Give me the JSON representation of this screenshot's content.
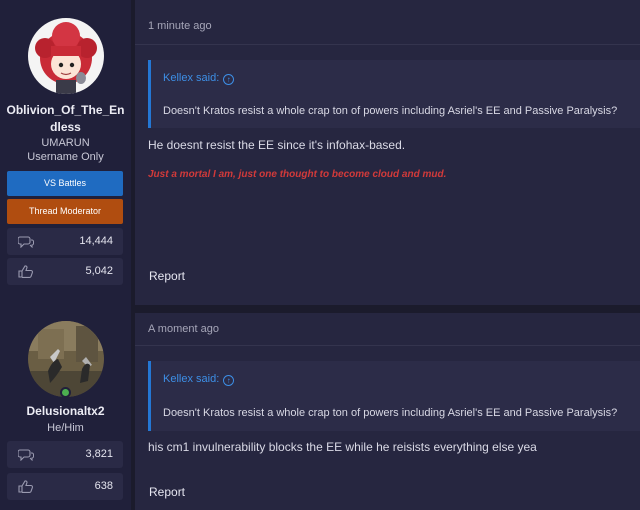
{
  "posts": [
    {
      "user": {
        "name_line1": "Oblivion_Of_The_En",
        "name_line2": "dless",
        "title1": "UMARUN",
        "title2": "Username Only",
        "banners": [
          "VS Battles",
          "Thread Moderator"
        ],
        "messages": "14,444",
        "reactions": "5,042"
      },
      "timestamp": "1 minute ago",
      "quote": {
        "author": "Kellex said:",
        "text": "Doesn't Kratos resist a whole crap ton of powers including Asriel's EE and Passive Paralysis?"
      },
      "message": "He doesnt resist the EE since it's infohax-based.",
      "signature": "Just a mortal I am, just one thought to become cloud and mud.",
      "report_label": "Report"
    },
    {
      "user": {
        "name": "Delusionaltx2",
        "title": "He/Him",
        "messages": "3,821",
        "reactions": "638"
      },
      "timestamp": "A moment ago",
      "quote": {
        "author": "Kellex said:",
        "text": "Doesn't Kratos resist a whole crap ton of powers including Asriel's EE and Passive Paralysis?"
      },
      "message": "his cm1 invulnerability blocks the EE while he reisists everything else yea",
      "report_label": "Report"
    }
  ],
  "colors": {
    "accent": "#2477d4",
    "vs_banner": "#1f6bc1",
    "moderator_banner": "#b04d10",
    "signature": "#d23a3a",
    "online": "#4caf50"
  },
  "icons": [
    "messages-icon",
    "reactions-icon",
    "quote-up-arrow-icon"
  ]
}
